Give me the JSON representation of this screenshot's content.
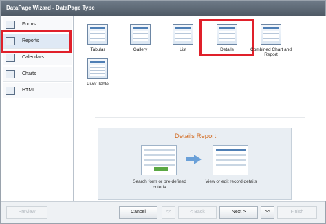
{
  "window": {
    "title": "DataPage Wizard - DataPage Type"
  },
  "sidebar": {
    "items": [
      {
        "label": "Forms",
        "icon": "form-icon"
      },
      {
        "label": "Reports",
        "icon": "report-icon",
        "selected": true
      },
      {
        "label": "Calendars",
        "icon": "calendar-icon"
      },
      {
        "label": "Charts",
        "icon": "chart-icon"
      },
      {
        "label": "HTML",
        "icon": "html-icon"
      }
    ]
  },
  "types": [
    {
      "label": "Tabular"
    },
    {
      "label": "Gallery"
    },
    {
      "label": "List"
    },
    {
      "label": "Details",
      "selected": true
    },
    {
      "label": "Combined Chart and Report"
    },
    {
      "label": "Pivot Table"
    }
  ],
  "preview": {
    "title": "Details Report",
    "left_caption": "Search form or pre-defined criteria",
    "right_caption": "View or edit record details"
  },
  "footer": {
    "preview": "Preview",
    "cancel": "Cancel",
    "first": "<<",
    "back": "< Back",
    "next": "Next >",
    "last": ">>",
    "finish": "Finish"
  },
  "colors": {
    "highlight": "#e0202a",
    "title_bar": "#5a6570",
    "preview_title": "#d2691e"
  }
}
